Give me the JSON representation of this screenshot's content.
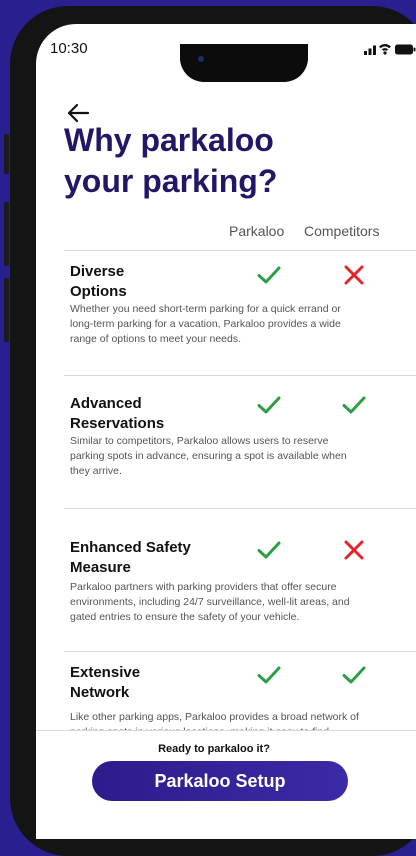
{
  "status_bar": {
    "time": "10:30",
    "icons": [
      "signal-icon",
      "wifi-icon",
      "battery-icon"
    ]
  },
  "nav": {
    "back_icon": "arrow-left-icon"
  },
  "title": {
    "line1": "Why parkaloo",
    "line2": "your parking?"
  },
  "columns": {
    "parkaloo": "Parkaloo",
    "competitors": "Competitors"
  },
  "features": [
    {
      "title_line1": "Diverse",
      "title_line2": "Options",
      "desc_line1": "Whether you need short-term parking for a quick errand or",
      "desc_line2": "long-term parking for a vacation, Parkaloo provides a wide",
      "desc_line3": "range of options to meet your needs.",
      "parkaloo": true,
      "competitors": false
    },
    {
      "title_line1": "Advanced",
      "title_line2": "Reservations",
      "desc_line1": "Similar to competitors, Parkaloo allows users to reserve",
      "desc_line2": "parking spots in advance, ensuring a spot is available when",
      "desc_line3": "they arrive.",
      "parkaloo": true,
      "competitors": true
    },
    {
      "title_line1": "Enhanced Safety",
      "title_line2": "Measure",
      "desc_line1": "Parkaloo partners with parking providers that offer secure",
      "desc_line2": "environments, including 24/7 surveillance, well-lit areas, and",
      "desc_line3": "gated entries to ensure the safety of your vehicle.",
      "parkaloo": true,
      "competitors": false
    },
    {
      "title_line1": "Extensive",
      "title_line2": "Network",
      "desc_line1": "Like other parking apps, Parkaloo provides a broad network of",
      "desc_line2": "parking spots in various locations, making it easy to find",
      "desc_line3": "",
      "parkaloo": true,
      "competitors": true
    }
  ],
  "footer": {
    "prompt": "Ready to parkaloo it?",
    "cta_label": "Parkaloo Setup"
  },
  "colors": {
    "background": "#2a1f8f",
    "title": "#241666",
    "check": "#2e9e46",
    "cross": "#e8222a",
    "cta": "#2e1c8c"
  }
}
